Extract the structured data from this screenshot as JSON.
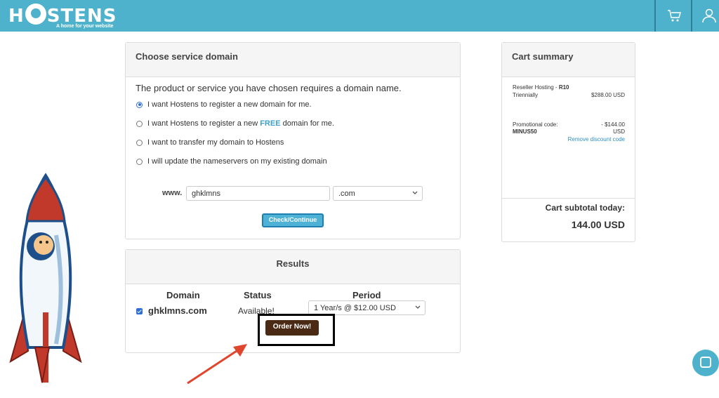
{
  "brand": {
    "name": "HOSTENS",
    "tagline": "A home for your website"
  },
  "header": {
    "icons": [
      "cart-icon",
      "user-icon"
    ]
  },
  "domain_panel": {
    "title": "Choose service domain",
    "prompt": "The product or service you have chosen requires a domain name.",
    "options": [
      {
        "label": "I want Hostens to register a new domain for me.",
        "selected": true
      },
      {
        "label_before": "I want Hostens to register a new ",
        "label_highlight": "FREE",
        "label_after": " domain for me.",
        "selected": false
      },
      {
        "label": "I want to transfer my domain to Hostens",
        "selected": false
      },
      {
        "label": "I will update the nameservers on my existing domain",
        "selected": false
      }
    ],
    "www_label": "www.",
    "domain_value": "ghklmns",
    "tld_value": ".com",
    "check_button": "Check/Continue"
  },
  "results_panel": {
    "title": "Results",
    "columns": [
      "Domain",
      "Status",
      "Period"
    ],
    "row": {
      "domain": "ghklmns.com",
      "status": "Available!",
      "period": "1 Year/s @ $12.00 USD",
      "checked": true
    },
    "order_button": "Order Now!"
  },
  "cart": {
    "title": "Cart summary",
    "product_name": "Reseller Hosting - ",
    "product_plan": "R10",
    "billing_cycle": "Triennially",
    "product_price": "$288.00 USD",
    "promo_label": "Promotional code:",
    "promo_code": "MINUS50",
    "promo_amount": "- $144.00",
    "promo_currency": "USD",
    "remove_link": "Remove discount code",
    "subtotal_label": "Cart subtotal today:",
    "subtotal_value": "144.00 USD"
  },
  "colors": {
    "header": "#4fb2cd",
    "order_button": "#4a2a15",
    "check_button": "#4db2d6",
    "annotation_arrow": "#e0452d"
  }
}
